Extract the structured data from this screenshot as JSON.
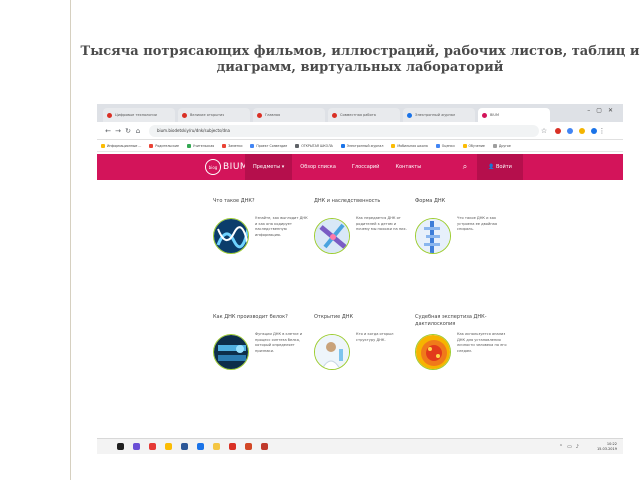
{
  "slide": {
    "title": "Тысяча потрясающих фильмов, иллюстраций, рабочих листов, таблиц и диаграмм, виртуальных лабораторий"
  },
  "browser": {
    "tabs": [
      {
        "label": "Цифровые технологии"
      },
      {
        "label": "Великие открытия"
      },
      {
        "label": "Главная"
      },
      {
        "label": "Совместная работа"
      },
      {
        "label": "Электронный журнал"
      },
      {
        "label": "BIUM",
        "active": true
      }
    ],
    "url": "bium.biodetskiy/ru/dnk/subjects/dna",
    "bookmarks": [
      "Информационные ...",
      "Родительские",
      "Учительская",
      "Заметки",
      "Проект Созвездие",
      "ОТКРЫТАЯ ШКОЛА",
      "Электронный журнал",
      "Мобильная школа",
      "Оценки",
      "Обучение",
      "Другое"
    ]
  },
  "site": {
    "logo_small": "biog",
    "logo_text": "BIUM",
    "menu": [
      {
        "label": "Предметы ▾",
        "active": true
      },
      {
        "label": "Обзор списка"
      },
      {
        "label": "Глоссарий"
      },
      {
        "label": "Контакты"
      }
    ],
    "login": "Войти"
  },
  "cards": [
    {
      "title": "Что такое ДНК?",
      "text": "Узнайте, как выглядит ДНК и как она кодирует наследственную информацию."
    },
    {
      "title": "ДНК и наследственность",
      "text": "Как передается ДНК от родителей к детям и почему мы похожи на них."
    },
    {
      "title": "Форма ДНК",
      "text": "Что такое ДНК и как устроена ее двойная спираль."
    },
    {
      "title": "Как ДНК производит белок?",
      "text": "Функции ДНК в клетке и процесс синтеза белка, который определяет признаки."
    },
    {
      "title": "Открытие ДНК",
      "text": "Кто и когда открыл структуру ДНК."
    },
    {
      "title": "Судебная экспертиза ДНК-дактилоскопия",
      "text": "Как используется анализ ДНК для установления личности человека по его следам."
    }
  ],
  "taskbar": {
    "time": "10:22",
    "date": "15.03.2019"
  }
}
